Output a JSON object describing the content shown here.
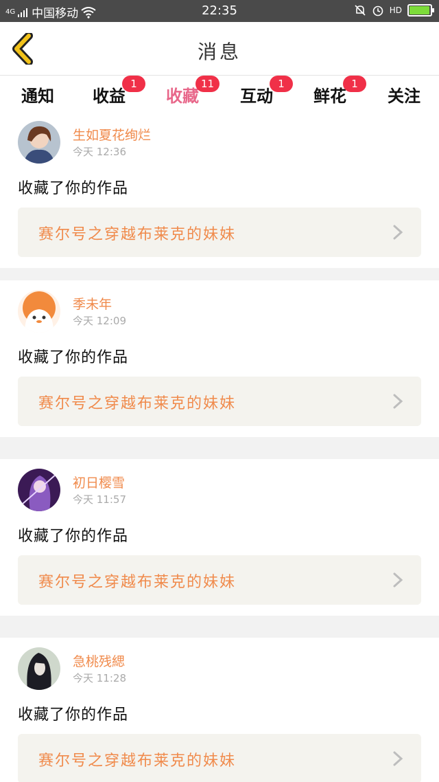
{
  "status_bar": {
    "network": "4G",
    "carrier": "中国移动",
    "time": "22:35",
    "hd": "HD",
    "icons": [
      "signal-icon",
      "wifi-icon",
      "mute-icon",
      "alarm-icon",
      "hd-call-icon",
      "battery-icon"
    ],
    "battery_level": 0.9,
    "battery_color": "#7ddc3a"
  },
  "header": {
    "title": "消息",
    "back_icon": "chevron-left-icon",
    "back_color": "#f2c21a"
  },
  "tabs": [
    {
      "label": "通知",
      "badge": ""
    },
    {
      "label": "收益",
      "badge": "1"
    },
    {
      "label": "收藏",
      "badge": "11",
      "active": true
    },
    {
      "label": "互动",
      "badge": "1"
    },
    {
      "label": "鲜花",
      "badge": "1"
    },
    {
      "label": "关注",
      "badge": ""
    }
  ],
  "colors": {
    "accent_pink": "#e8678a",
    "badge_red": "#f03048",
    "name_orange": "#f08a4b"
  },
  "messages": [
    {
      "user": "生如夏花绚烂",
      "time": "今天 12:36",
      "action": "收藏了你的作品",
      "work": "赛尔号之穿越布莱克的妹妹"
    },
    {
      "user": "季未年",
      "time": "今天 12:09",
      "action": "收藏了你的作品",
      "work": "赛尔号之穿越布莱克的妹妹"
    },
    {
      "user": "初日樱雪",
      "time": "今天 11:57",
      "action": "收藏了你的作品",
      "work": "赛尔号之穿越布莱克的妹妹"
    },
    {
      "user": "急桃残緦",
      "time": "今天 11:28",
      "action": "收藏了你的作品",
      "work": "赛尔号之穿越布莱克的妹妹"
    }
  ]
}
